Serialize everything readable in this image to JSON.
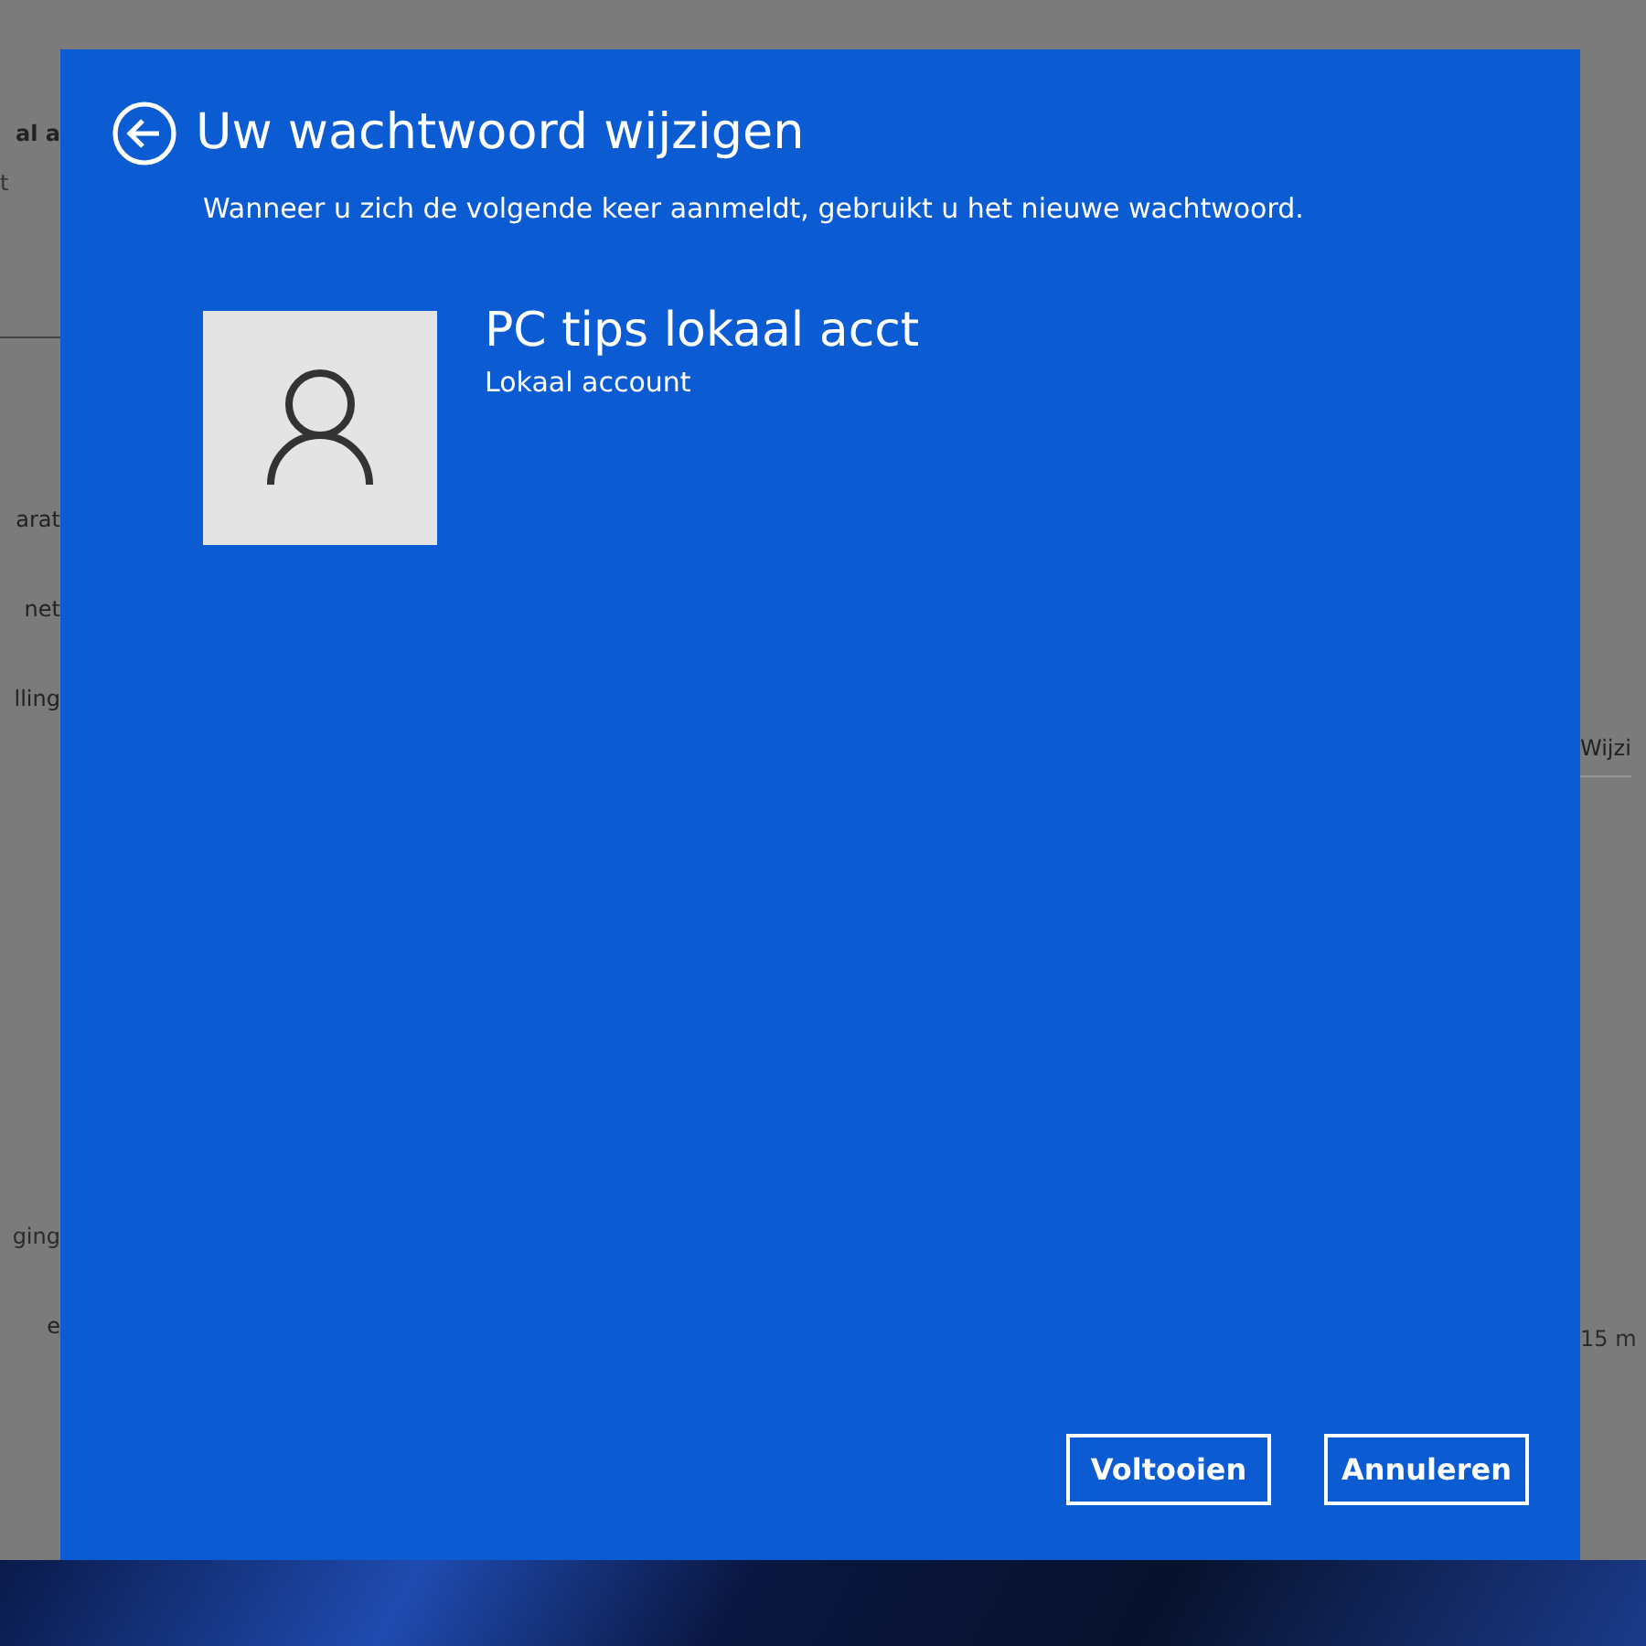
{
  "background_window": {
    "left_fragments": [
      {
        "text": "al a",
        "kind": "heading"
      },
      {
        "text": "t",
        "kind": "sub"
      },
      {
        "text": "arat",
        "kind": "item"
      },
      {
        "text": "net",
        "kind": "item"
      },
      {
        "text": "lling",
        "kind": "item"
      },
      {
        "text": "ging",
        "kind": "lower"
      },
      {
        "text": "e",
        "kind": "item"
      }
    ],
    "right_fragments": [
      {
        "text": "Wijzi",
        "kind": "button"
      },
      {
        "text": "15 m",
        "kind": "lower"
      }
    ]
  },
  "dialog": {
    "title": "Uw wachtwoord wijzigen",
    "description": "Wanneer u zich de volgende keer aanmeldt, gebruikt u het nieuwe wachtwoord.",
    "account": {
      "name": "PC tips lokaal acct",
      "type": "Lokaal account"
    },
    "buttons": [
      "Voltooien",
      "Annuleren"
    ]
  }
}
